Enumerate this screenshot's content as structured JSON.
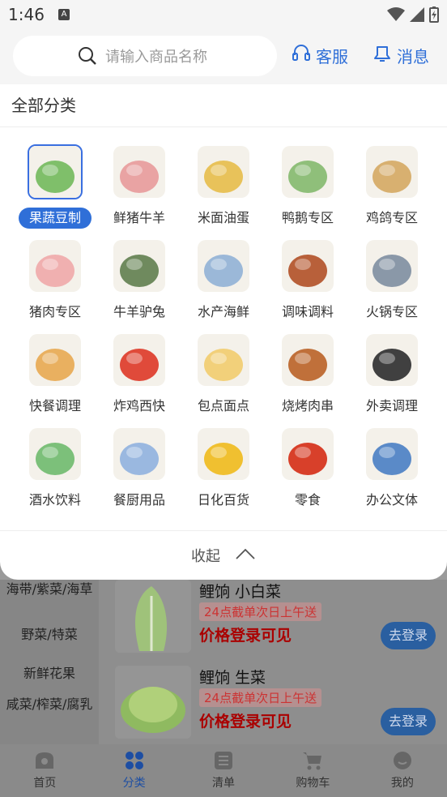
{
  "status": {
    "time": "1:46",
    "notif_icon": "a-icon"
  },
  "search": {
    "placeholder": "请输入商品名称"
  },
  "header": {
    "service_label": "客服",
    "message_label": "消息"
  },
  "panel": {
    "title": "全部分类",
    "collapse_label": "收起",
    "categories": [
      {
        "label": "果蔬豆制",
        "active": true,
        "icon": "vegetables-icon",
        "color": "#7fbf6a"
      },
      {
        "label": "鲜猪牛羊",
        "icon": "meat-icon",
        "color": "#e9a3a3"
      },
      {
        "label": "米面油蛋",
        "icon": "oil-egg-icon",
        "color": "#e8c25a"
      },
      {
        "label": "鸭鹅专区",
        "icon": "goose-icon",
        "color": "#8fbf7a"
      },
      {
        "label": "鸡鸽专区",
        "icon": "chicken-icon",
        "color": "#d8b070"
      },
      {
        "label": "猪肉专区",
        "icon": "pig-icon",
        "color": "#f0b0b0"
      },
      {
        "label": "牛羊驴兔",
        "icon": "cow-icon",
        "color": "#6f8a5e"
      },
      {
        "label": "水产海鲜",
        "icon": "seafood-icon",
        "color": "#9bb8d8"
      },
      {
        "label": "调味调料",
        "icon": "sauce-icon",
        "color": "#b8603a"
      },
      {
        "label": "火锅专区",
        "icon": "hotpot-icon",
        "color": "#8a98a8"
      },
      {
        "label": "快餐调理",
        "icon": "fastfood-icon",
        "color": "#e9b060"
      },
      {
        "label": "炸鸡西快",
        "icon": "burger-icon",
        "color": "#e04a3a"
      },
      {
        "label": "包点面点",
        "icon": "bun-icon",
        "color": "#f2d07a"
      },
      {
        "label": "烧烤肉串",
        "icon": "bbq-icon",
        "color": "#c0703a"
      },
      {
        "label": "外卖调理",
        "icon": "bento-icon",
        "color": "#404040"
      },
      {
        "label": "酒水饮料",
        "icon": "drinks-icon",
        "color": "#7cc07a"
      },
      {
        "label": "餐厨用品",
        "icon": "tableware-icon",
        "color": "#9ab8e0"
      },
      {
        "label": "日化百货",
        "icon": "detergent-icon",
        "color": "#f0c030"
      },
      {
        "label": "零食",
        "icon": "snacks-icon",
        "color": "#d8402a"
      },
      {
        "label": "办公文体",
        "icon": "office-icon",
        "color": "#5a8ac8"
      }
    ]
  },
  "left_nav": [
    "海带/紫菜/海草",
    "野菜/特菜",
    "新鲜花果",
    "咸菜/榨菜/腐乳"
  ],
  "products": [
    {
      "name": "鲤饷 小白菜",
      "tag": "24点截单次日上午送",
      "price": "价格登录可见",
      "button": "去登录"
    },
    {
      "name": "鲤饷 生菜",
      "tag": "24点截单次日上午送",
      "price": "价格登录可见",
      "button": "去登录"
    }
  ],
  "tabs": [
    {
      "label": "首页",
      "icon": "home-icon"
    },
    {
      "label": "分类",
      "icon": "category-icon",
      "active": true
    },
    {
      "label": "清单",
      "icon": "list-icon"
    },
    {
      "label": "购物车",
      "icon": "cart-icon"
    },
    {
      "label": "我的",
      "icon": "profile-icon"
    }
  ]
}
